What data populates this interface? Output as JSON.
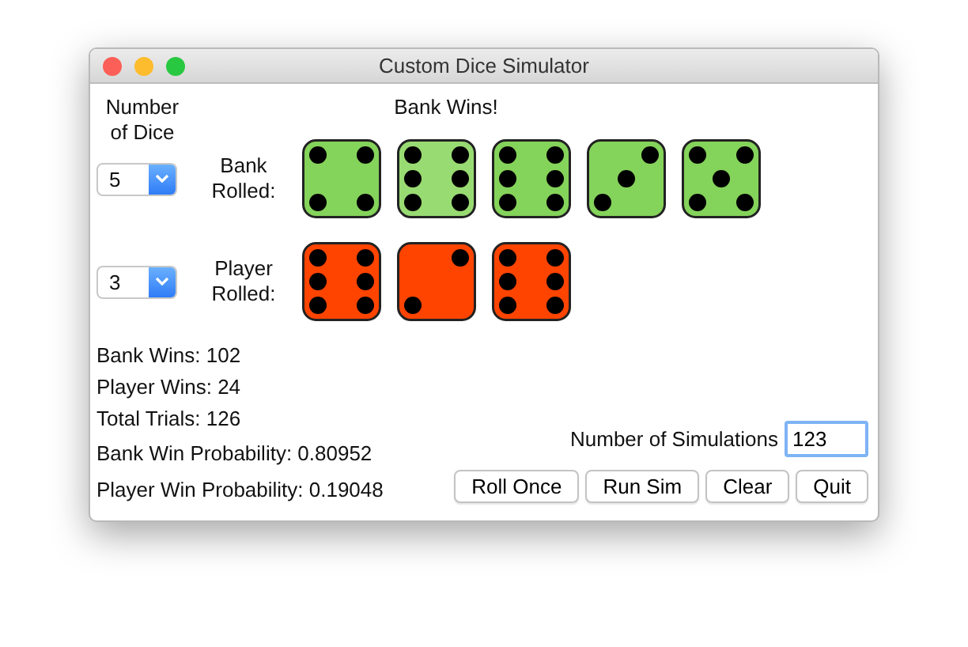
{
  "window": {
    "title": "Custom Dice Simulator"
  },
  "dice_count_heading": "Number of Dice",
  "result": "Bank Wins!",
  "rows": [
    {
      "count": "5",
      "label": "Bank Rolled:",
      "dice": [
        {
          "kind": "four",
          "color": "#84d35a"
        },
        {
          "kind": "six",
          "color": "#98db72"
        },
        {
          "kind": "six",
          "color": "#84d35a"
        },
        {
          "kind": "three",
          "color": "#84d35a"
        },
        {
          "kind": "five",
          "color": "#84d35a"
        }
      ]
    },
    {
      "count": "3",
      "label": "Player Rolled:",
      "dice": [
        {
          "kind": "six",
          "color": "#ff4400"
        },
        {
          "kind": "two",
          "color": "#ff4400"
        },
        {
          "kind": "six",
          "color": "#ff4400"
        }
      ]
    }
  ],
  "stats": [
    "Bank Wins: 102",
    "Player Wins: 24",
    "Total Trials: 126",
    "Bank Win Probability: 0.80952",
    "Player Win Probability: 0.19048"
  ],
  "simulations": {
    "label": "Number of Simulations",
    "value": "123"
  },
  "buttons": [
    "Roll Once",
    "Run Sim",
    "Clear",
    "Quit"
  ]
}
